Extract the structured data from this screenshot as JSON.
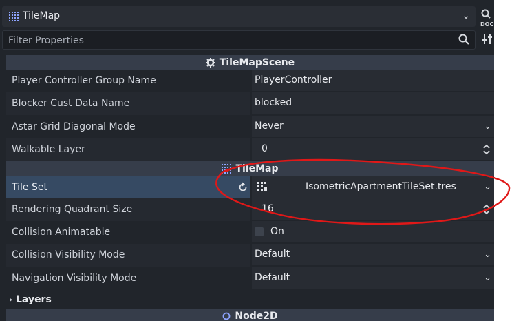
{
  "node_selector": {
    "label": "TileMap",
    "icon": "tilemap-grid-icon"
  },
  "filter": {
    "placeholder": "Filter Properties"
  },
  "sections": {
    "tilemapscene": "TileMapScene",
    "tilemap": "TileMap",
    "node2d": "Node2D"
  },
  "properties": {
    "player_group": {
      "label": "Player Controller Group Name",
      "value": "PlayerController"
    },
    "blocker": {
      "label": "Blocker Cust Data Name",
      "value": "blocked"
    },
    "astar": {
      "label": "Astar Grid Diagonal Mode",
      "value": "Never"
    },
    "walkable": {
      "label": "Walkable Layer",
      "value": "0"
    },
    "tileset": {
      "label": "Tile Set",
      "value": "IsometricApartmentTileSet.tres"
    },
    "quadrant": {
      "label": "Rendering Quadrant Size",
      "value": "16"
    },
    "collision_anim": {
      "label": "Collision Animatable",
      "value": "On"
    },
    "collision_vis": {
      "label": "Collision Visibility Mode",
      "value": "Default"
    },
    "nav_vis": {
      "label": "Navigation Visibility Mode",
      "value": "Default"
    }
  },
  "layers": {
    "label": "Layers"
  },
  "doc_button": {
    "label": "DOC"
  },
  "colors": {
    "panel_bg": "#21252b",
    "section_header": "#363d4a",
    "selected_row": "#364a63",
    "annotation": "#e01818"
  }
}
